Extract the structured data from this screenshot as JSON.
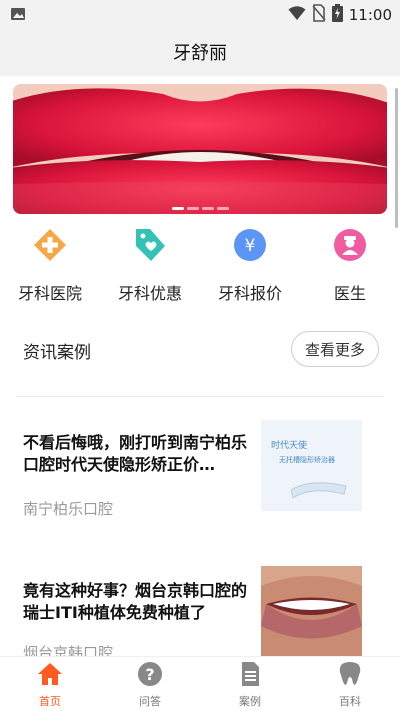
{
  "status_bar": {
    "time": "11:00",
    "icons": [
      "image-icon",
      "wifi-icon",
      "no-sim-icon",
      "battery-charging-icon"
    ]
  },
  "header": {
    "title": "牙舒丽"
  },
  "banner": {
    "slides": 4,
    "active_slide": 0
  },
  "categories": [
    {
      "label": "牙科医院",
      "icon": "hospital-cross-icon",
      "color": "#f5a845"
    },
    {
      "label": "牙科优惠",
      "icon": "discount-tag-icon",
      "color": "#34c2b4"
    },
    {
      "label": "牙科报价",
      "icon": "yen-price-icon",
      "color": "#5b95f5"
    },
    {
      "label": "医生",
      "icon": "doctor-icon",
      "color": "#f15ca0"
    }
  ],
  "section": {
    "title": "资讯案例",
    "more_label": "查看更多"
  },
  "news": [
    {
      "headline": "不看后悔哦，刚打听到南宁柏乐口腔时代天使隐形矫正价…",
      "source": "南宁柏乐口腔",
      "thumb_text_1": "时代天使",
      "thumb_text_2": "无托槽隐形矫治器"
    },
    {
      "headline": "竟有这种好事？烟台京韩口腔的瑞士ITI种植体免费种植了",
      "source": "烟台京韩口腔"
    }
  ],
  "bottom_nav": [
    {
      "label": "首页",
      "icon": "home-icon",
      "active": true
    },
    {
      "label": "问答",
      "icon": "question-icon",
      "active": false
    },
    {
      "label": "案例",
      "icon": "document-icon",
      "active": false
    },
    {
      "label": "百科",
      "icon": "tooth-icon",
      "active": false
    }
  ],
  "colors": {
    "accent": "#ff5a1f",
    "status_bar_bg": "#f2f2f2"
  }
}
